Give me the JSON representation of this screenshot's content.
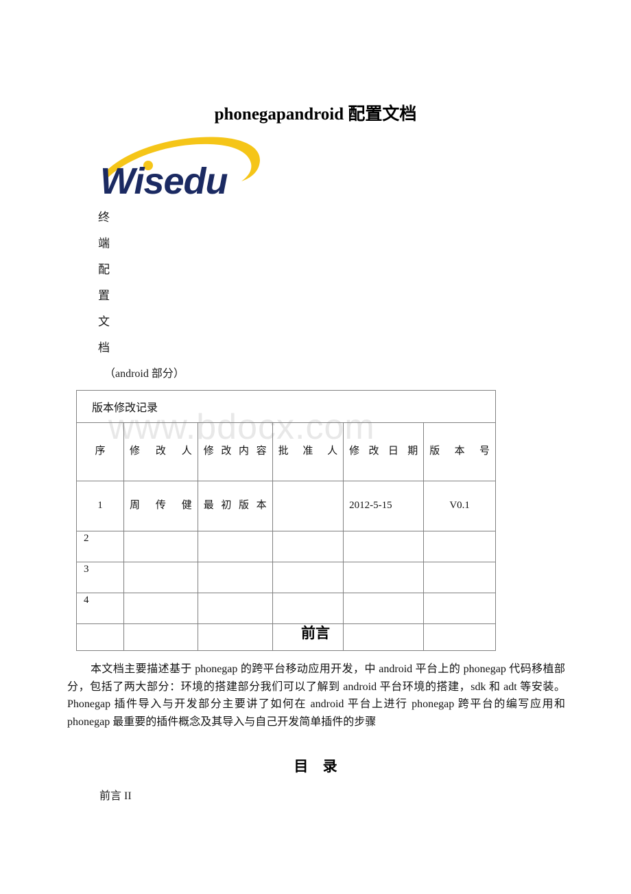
{
  "document": {
    "title": "phonegapandroid 配置文档",
    "watermark": "www.bdocx.com"
  },
  "logo": {
    "name": "Wisedu",
    "wordmark": "Wisedu",
    "text_color": "#1b2a62",
    "swoosh_color": "#f5c518"
  },
  "vertical_title": {
    "chars": [
      "终",
      "端",
      "配",
      "置",
      "文",
      "档"
    ],
    "subtitle": "（android 部分）"
  },
  "version_table": {
    "caption": "版本修改记录",
    "headers": [
      "序",
      "修改人",
      "修改内容",
      "批准人",
      "修改日期",
      "版本号"
    ],
    "rows": [
      {
        "seq": "1",
        "modifier": "周传健",
        "content": "最初版本",
        "approver": "",
        "date": "2012-5-15",
        "version": "V0.1"
      },
      {
        "seq": "2",
        "modifier": "",
        "content": "",
        "approver": "",
        "date": "",
        "version": ""
      },
      {
        "seq": "3",
        "modifier": "",
        "content": "",
        "approver": "",
        "date": "",
        "version": ""
      },
      {
        "seq": "4",
        "modifier": "",
        "content": "",
        "approver": "",
        "date": "",
        "version": ""
      },
      {
        "seq": "",
        "modifier": "",
        "content": "",
        "approver": "",
        "date": "",
        "version": ""
      }
    ]
  },
  "preface": {
    "heading": "前言",
    "body": "本文档主要描述基于 phonegap 的跨平台移动应用开发，中 android 平台上的 phonegap 代码移植部分，包括了两大部分：环境的搭建部分我们可以了解到 android 平台环境的搭建，sdk 和 adt 等安装。Phonegap 插件导入与开发部分主要讲了如何在 android 平台上进行 phonegap 跨平台的编写应用和 phonegap 最重要的插件概念及其导入与自己开发简单插件的步骤"
  },
  "toc": {
    "heading": "目 录",
    "items": [
      {
        "label": "前言 II"
      }
    ]
  }
}
